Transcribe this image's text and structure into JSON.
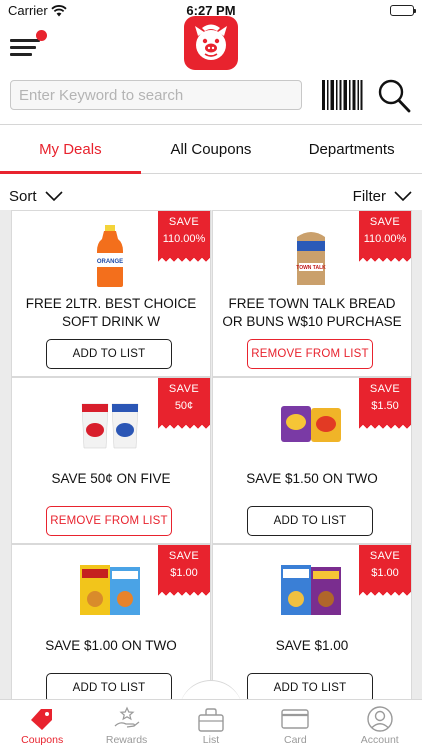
{
  "status_bar": {
    "carrier": "Carrier",
    "time": "6:27 PM"
  },
  "search": {
    "placeholder": "Enter Keyword to search",
    "value": ""
  },
  "tabs": [
    {
      "label": "My Deals",
      "active": true
    },
    {
      "label": "All Coupons",
      "active": false
    },
    {
      "label": "Departments",
      "active": false
    }
  ],
  "sort_label": "Sort",
  "filter_label": "Filter",
  "deals": [
    {
      "save_label": "SAVE",
      "save_value": "110.00%",
      "title": "FREE 2LTR. BEST CHOICE SOFT DRINK W",
      "button": "ADD TO LIST",
      "image": "soda-bottle"
    },
    {
      "save_label": "SAVE",
      "save_value": "110.00%",
      "title": "FREE TOWN TALK BREAD OR BUNS W$10 PURCHASE",
      "button": "REMOVE FROM LIST",
      "image": "bread-loaf"
    },
    {
      "save_label": "SAVE",
      "save_value": "50¢",
      "title": "SAVE 50¢ ON FIVE",
      "button": "REMOVE FROM LIST",
      "image": "yogurt-cups"
    },
    {
      "save_label": "SAVE",
      "save_value": "$1.50",
      "title": "SAVE $1.50 ON TWO",
      "button": "ADD TO LIST",
      "image": "snack-bags"
    },
    {
      "save_label": "SAVE",
      "save_value": "$1.00",
      "title": "SAVE $1.00 ON TWO",
      "button": "ADD TO LIST",
      "image": "cereal-boxes"
    },
    {
      "save_label": "SAVE",
      "save_value": "$1.00",
      "title": "SAVE $1.00",
      "button": "ADD TO LIST",
      "image": "cereal-boxes-2"
    }
  ],
  "bottom_nav": [
    {
      "label": "Coupons",
      "icon": "tag-icon",
      "active": true
    },
    {
      "label": "Rewards",
      "icon": "rewards-icon",
      "active": false
    },
    {
      "label": "List",
      "icon": "list-bag-icon",
      "active": false
    },
    {
      "label": "Card",
      "icon": "card-icon",
      "active": false
    },
    {
      "label": "Account",
      "icon": "account-icon",
      "active": false
    }
  ],
  "colors": {
    "brand": "#e8232e",
    "text": "#111111",
    "inactive": "#9a9a9a",
    "grid_bg": "#ebebeb"
  }
}
